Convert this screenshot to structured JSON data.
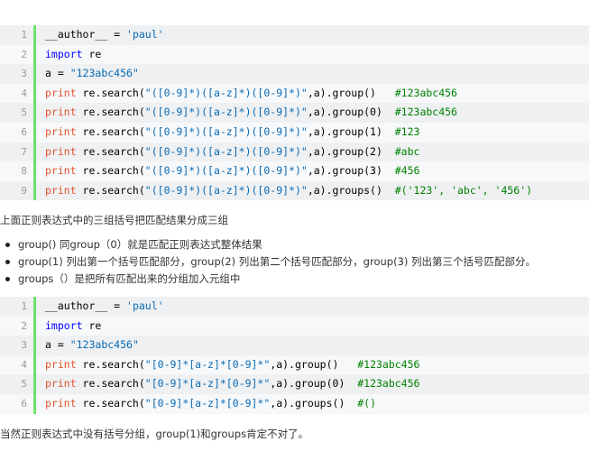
{
  "block1": {
    "lines": [
      {
        "no": "1",
        "parts": [
          {
            "t": "    __author__ = ",
            "c": "plain"
          },
          {
            "t": "'paul'",
            "c": "str"
          }
        ]
      },
      {
        "no": "2",
        "parts": [
          {
            "t": "import",
            "c": "kw"
          },
          {
            "t": " re",
            "c": "plain"
          }
        ]
      },
      {
        "no": "3",
        "parts": [
          {
            "t": "a = ",
            "c": "plain"
          },
          {
            "t": "\"123abc456\"",
            "c": "str"
          }
        ]
      },
      {
        "no": "4",
        "parts": [
          {
            "t": "print",
            "c": "pr"
          },
          {
            "t": " re.search(",
            "c": "plain"
          },
          {
            "t": "\"([0-9]*)([a-z]*)([0-9]*)\"",
            "c": "str"
          },
          {
            "t": ",a).group()   ",
            "c": "plain"
          },
          {
            "t": "#123abc456",
            "c": "cm"
          }
        ]
      },
      {
        "no": "5",
        "parts": [
          {
            "t": "print",
            "c": "pr"
          },
          {
            "t": " re.search(",
            "c": "plain"
          },
          {
            "t": "\"([0-9]*)([a-z]*)([0-9]*)\"",
            "c": "str"
          },
          {
            "t": ",a).group(0)  ",
            "c": "plain"
          },
          {
            "t": "#123abc456",
            "c": "cm"
          }
        ]
      },
      {
        "no": "6",
        "parts": [
          {
            "t": "print",
            "c": "pr"
          },
          {
            "t": " re.search(",
            "c": "plain"
          },
          {
            "t": "\"([0-9]*)([a-z]*)([0-9]*)\"",
            "c": "str"
          },
          {
            "t": ",a).group(1)  ",
            "c": "plain"
          },
          {
            "t": "#123",
            "c": "cm"
          }
        ]
      },
      {
        "no": "7",
        "parts": [
          {
            "t": "print",
            "c": "pr"
          },
          {
            "t": " re.search(",
            "c": "plain"
          },
          {
            "t": "\"([0-9]*)([a-z]*)([0-9]*)\"",
            "c": "str"
          },
          {
            "t": ",a).group(2)  ",
            "c": "plain"
          },
          {
            "t": "#abc",
            "c": "cm"
          }
        ]
      },
      {
        "no": "8",
        "parts": [
          {
            "t": "print",
            "c": "pr"
          },
          {
            "t": " re.search(",
            "c": "plain"
          },
          {
            "t": "\"([0-9]*)([a-z]*)([0-9]*)\"",
            "c": "str"
          },
          {
            "t": ",a).group(3)  ",
            "c": "plain"
          },
          {
            "t": "#456",
            "c": "cm"
          }
        ]
      },
      {
        "no": "9",
        "parts": [
          {
            "t": "print",
            "c": "pr"
          },
          {
            "t": " re.search(",
            "c": "plain"
          },
          {
            "t": "\"([0-9]*)([a-z]*)([0-9]*)\"",
            "c": "str"
          },
          {
            "t": ",a).groups()  ",
            "c": "plain"
          },
          {
            "t": "#('123', 'abc', '456')",
            "c": "cm"
          }
        ]
      }
    ]
  },
  "paragraph1": "上面正则表达式中的三组括号把匹配结果分成三组",
  "bullets": [
    "group() 同group（0）就是匹配正则表达式整体结果",
    "group(1) 列出第一个括号匹配部分，group(2) 列出第二个括号匹配部分，group(3) 列出第三个括号匹配部分。",
    "groups（）是把所有匹配出来的分组加入元组中"
  ],
  "block2": {
    "lines": [
      {
        "no": "1",
        "parts": [
          {
            "t": "    __author__ = ",
            "c": "plain"
          },
          {
            "t": "'paul'",
            "c": "str"
          }
        ]
      },
      {
        "no": "2",
        "parts": [
          {
            "t": "import",
            "c": "kw"
          },
          {
            "t": " re",
            "c": "plain"
          }
        ]
      },
      {
        "no": "3",
        "parts": [
          {
            "t": "a = ",
            "c": "plain"
          },
          {
            "t": "\"123abc456\"",
            "c": "str"
          }
        ]
      },
      {
        "no": "4",
        "parts": [
          {
            "t": "print",
            "c": "pr"
          },
          {
            "t": " re.search(",
            "c": "plain"
          },
          {
            "t": "\"[0-9]*[a-z]*[0-9]*\"",
            "c": "str"
          },
          {
            "t": ",a).group()   ",
            "c": "plain"
          },
          {
            "t": "#123abc456",
            "c": "cm"
          }
        ]
      },
      {
        "no": "5",
        "parts": [
          {
            "t": "print",
            "c": "pr"
          },
          {
            "t": " re.search(",
            "c": "plain"
          },
          {
            "t": "\"[0-9]*[a-z]*[0-9]*\"",
            "c": "str"
          },
          {
            "t": ",a).group(0)  ",
            "c": "plain"
          },
          {
            "t": "#123abc456",
            "c": "cm"
          }
        ]
      },
      {
        "no": "6",
        "parts": [
          {
            "t": "print",
            "c": "pr"
          },
          {
            "t": " re.search(",
            "c": "plain"
          },
          {
            "t": "\"[0-9]*[a-z]*[0-9]*\"",
            "c": "str"
          },
          {
            "t": ",a).groups()  ",
            "c": "plain"
          },
          {
            "t": "#()",
            "c": "cm"
          }
        ]
      }
    ]
  },
  "paragraph2": "当然正则表达式中没有括号分组，group(1)和groups肯定不对了。"
}
